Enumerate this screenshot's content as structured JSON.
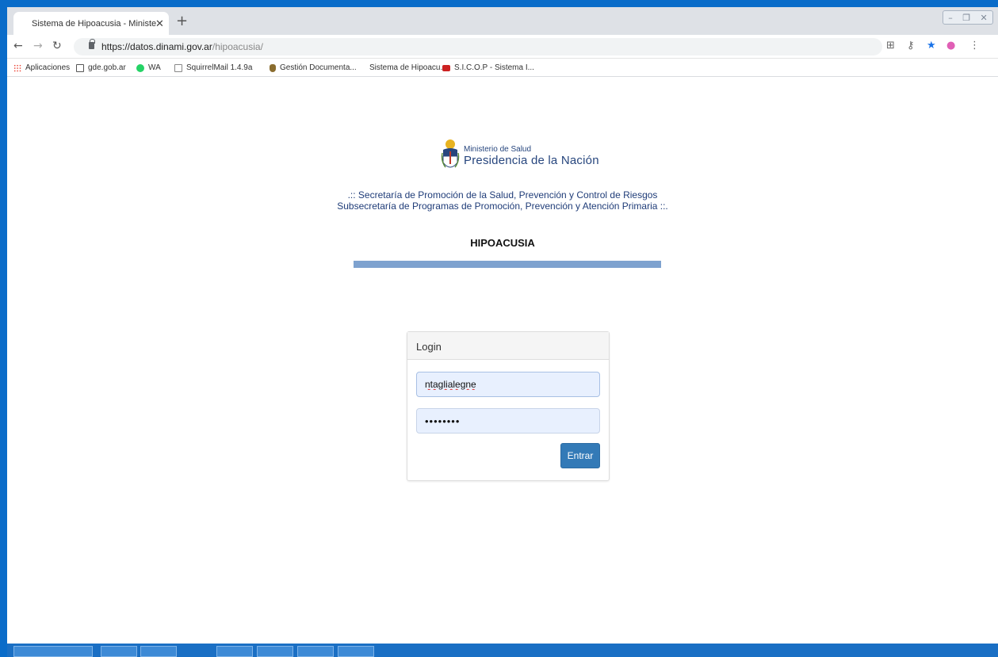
{
  "browser": {
    "tab_title": "Sistema de Hipoacusia - Ministe",
    "tab_close": "✕",
    "new_tab": "+",
    "url_host": "https://datos.dinami.gov.ar",
    "url_path": "/hipoacusia/"
  },
  "bookmarks": [
    {
      "label": "Aplicaciones",
      "icon": "apps-grid-icon",
      "color": "#4285f4"
    },
    {
      "label": "gde.gob.ar",
      "icon": "document-icon",
      "color": "#555555"
    },
    {
      "label": "WA",
      "icon": "whatsapp-icon",
      "color": "#25d366"
    },
    {
      "label": "SquirrelMail 1.4.9a",
      "icon": "page-icon",
      "color": "#888888"
    },
    {
      "label": "Gestión Documenta...",
      "icon": "escudo-icon",
      "color": "#8a6d2f"
    },
    {
      "label": "Sistema de Hipoacu...",
      "icon": "",
      "color": ""
    },
    {
      "label": "S.I.C.O.P - Sistema I...",
      "icon": "sicop-icon",
      "color": "#cc2222"
    }
  ],
  "header": {
    "ministerio": "Ministerio de Salud",
    "presidencia": "Presidencia de la Nación",
    "secretaria_line1": ".:: Secretaría de Promoción de la Salud, Prevención y Control de Riesgos",
    "secretaria_line2": "Subsecretaría de Programas de Promoción, Prevención y Atención Primaria ::.",
    "app_title": "HIPOACUSIA"
  },
  "login": {
    "heading": "Login",
    "username": "ntaglialegne",
    "password": "••••••••",
    "submit_label": "Entrar"
  },
  "colors": {
    "accent_bar": "#7ea2cf",
    "button": "#337ab7",
    "brand_text": "#27467e"
  }
}
